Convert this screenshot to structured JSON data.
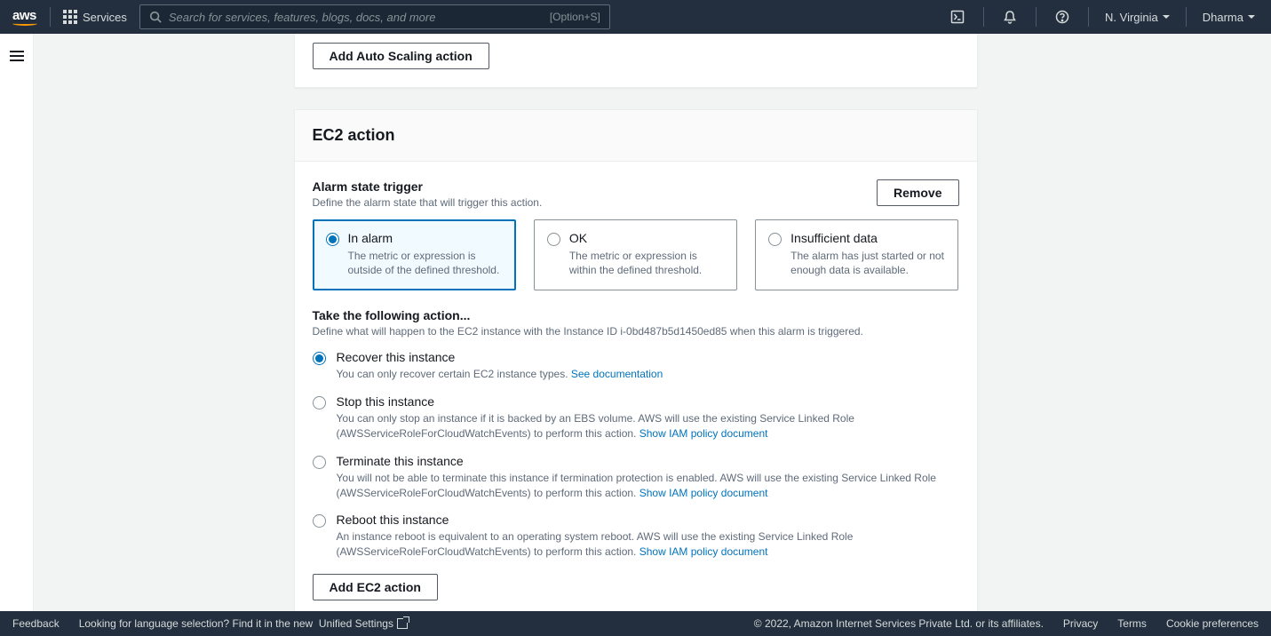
{
  "nav": {
    "services": "Services",
    "search_placeholder": "Search for services, features, blogs, docs, and more",
    "search_kbd": "[Option+S]",
    "region": "N. Virginia",
    "user": "Dharma"
  },
  "prev_card": {
    "add_autoscaling": "Add Auto Scaling action"
  },
  "ec2": {
    "title": "EC2 action",
    "remove": "Remove",
    "trigger_title": "Alarm state trigger",
    "trigger_desc": "Define the alarm state that will trigger this action.",
    "tiles": [
      {
        "label": "In alarm",
        "desc": "The metric or expression is outside of the defined threshold.",
        "selected": true
      },
      {
        "label": "OK",
        "desc": "The metric or expression is within the defined threshold.",
        "selected": false
      },
      {
        "label": "Insufficient data",
        "desc": "The alarm has just started or not enough data is available.",
        "selected": false
      }
    ],
    "take_title": "Take the following action...",
    "take_desc": "Define what will happen to the EC2 instance with the Instance ID i-0bd487b5d1450ed85 when this alarm is triggered.",
    "actions": [
      {
        "label": "Recover this instance",
        "desc": "You can only recover certain EC2 instance types. ",
        "link": "See documentation",
        "selected": true
      },
      {
        "label": "Stop this instance",
        "desc": "You can only stop an instance if it is backed by an EBS volume. AWS will use the existing Service Linked Role (AWSServiceRoleForCloudWatchEvents) to perform this action. ",
        "link": "Show IAM policy document",
        "selected": false
      },
      {
        "label": "Terminate this instance",
        "desc": "You will not be able to terminate this instance if termination protection is enabled. AWS will use the existing Service Linked Role (AWSServiceRoleForCloudWatchEvents) to perform this action. ",
        "link": "Show IAM policy document",
        "selected": false
      },
      {
        "label": "Reboot this instance",
        "desc": "An instance reboot is equivalent to an operating system reboot. AWS will use the existing Service Linked Role (AWSServiceRoleForCloudWatchEvents) to perform this action. ",
        "link": "Show IAM policy document",
        "selected": false
      }
    ],
    "add_ec2": "Add EC2 action"
  },
  "footer": {
    "feedback": "Feedback",
    "lang_prompt": "Looking for language selection? Find it in the new",
    "unified": "Unified Settings",
    "copyright": "© 2022, Amazon Internet Services Private Ltd. or its affiliates.",
    "privacy": "Privacy",
    "terms": "Terms",
    "cookies": "Cookie preferences"
  }
}
